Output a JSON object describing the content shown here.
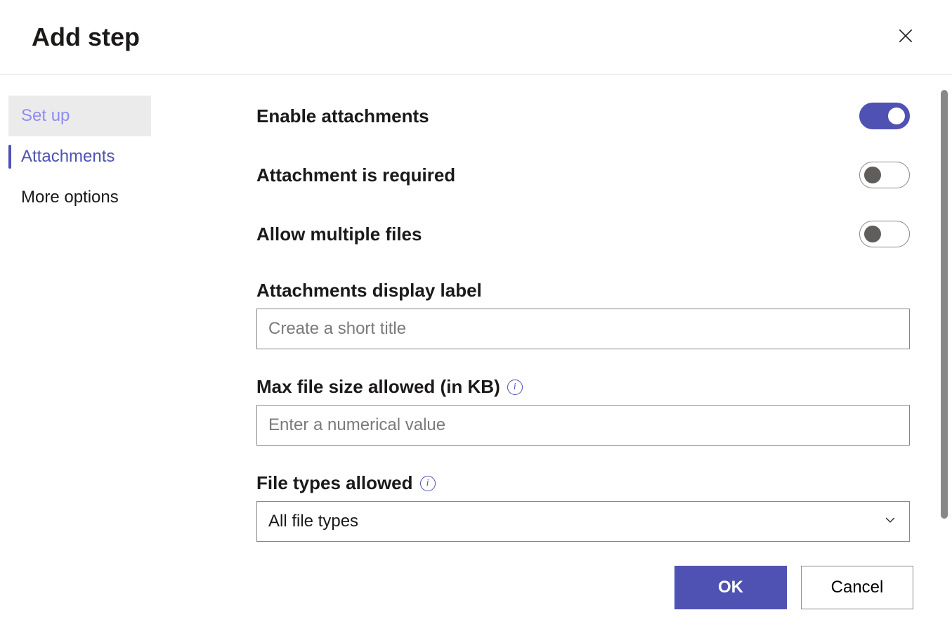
{
  "dialog": {
    "title": "Add step"
  },
  "sidebar": {
    "items": [
      {
        "label": "Set up",
        "state": "visited"
      },
      {
        "label": "Attachments",
        "state": "active"
      },
      {
        "label": "More options",
        "state": "default"
      }
    ]
  },
  "form": {
    "enable_attachments": {
      "label": "Enable attachments",
      "value": true
    },
    "attachment_required": {
      "label": "Attachment is required",
      "value": false
    },
    "allow_multiple": {
      "label": "Allow multiple files",
      "value": false
    },
    "display_label": {
      "label": "Attachments display label",
      "placeholder": "Create a short title",
      "value": ""
    },
    "max_file_size": {
      "label": "Max file size allowed (in KB)",
      "placeholder": "Enter a numerical value",
      "value": ""
    },
    "file_types": {
      "label": "File types allowed",
      "selected": "All file types"
    }
  },
  "footer": {
    "ok": "OK",
    "cancel": "Cancel"
  },
  "colors": {
    "primary": "#4f52b2"
  }
}
